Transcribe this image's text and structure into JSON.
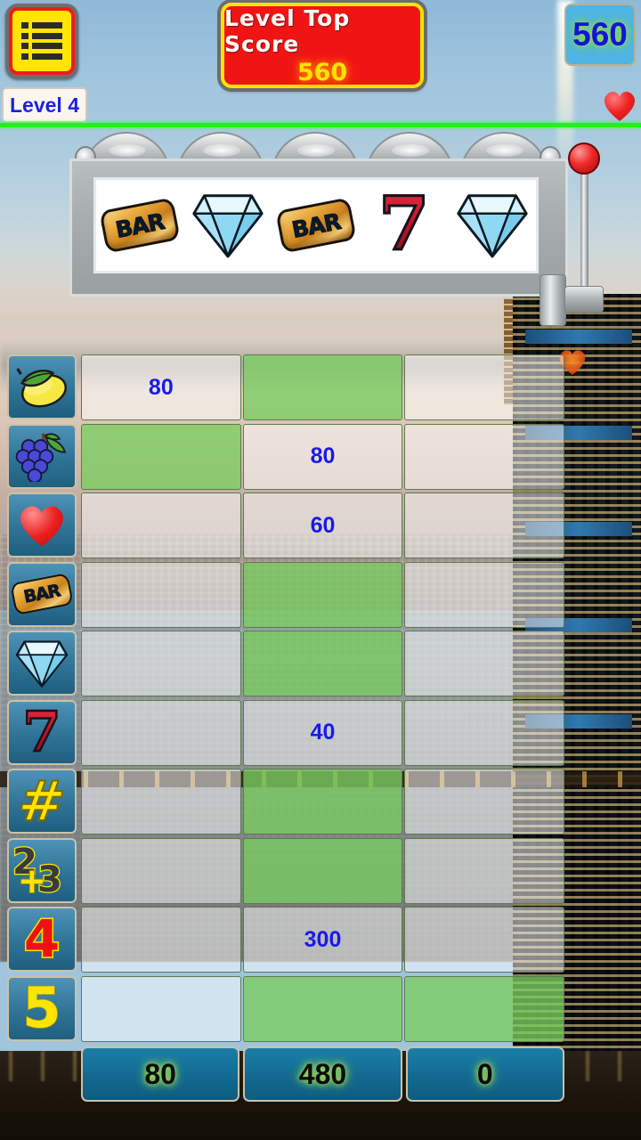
{
  "hud": {
    "menu_icon": "list-menu-icon",
    "level_label": "Level 4",
    "top_score_label": "Level Top Score",
    "top_score_value": "560",
    "current_score": "560",
    "life_icon": "heart-icon",
    "colors": {
      "panel_red": "#f01414",
      "panel_border_yellow": "#ffe400",
      "score_blue": "#1414d8",
      "score_box_bg": "#4fb4e3",
      "divider_green": "#22ef22"
    }
  },
  "slot_machine": {
    "reel_count": 5,
    "reels": [
      {
        "symbol": "bar",
        "label": "BAR"
      },
      {
        "symbol": "diamond",
        "label": ""
      },
      {
        "symbol": "bar",
        "label": "BAR"
      },
      {
        "symbol": "seven",
        "label": "7"
      },
      {
        "symbol": "diamond",
        "label": ""
      }
    ],
    "lever_icon": "slot-lever-handle"
  },
  "scorecard": {
    "column_count": 3,
    "rows": [
      {
        "icon": "lemon-icon",
        "cells": [
          {
            "value": "80",
            "state": "neutral"
          },
          {
            "value": "",
            "state": "green"
          },
          {
            "value": "",
            "state": "neutral"
          }
        ]
      },
      {
        "icon": "grapes-icon",
        "cells": [
          {
            "value": "",
            "state": "green"
          },
          {
            "value": "80",
            "state": "neutral"
          },
          {
            "value": "",
            "state": "neutral"
          }
        ]
      },
      {
        "icon": "heart-icon",
        "cells": [
          {
            "value": "",
            "state": "neutral"
          },
          {
            "value": "60",
            "state": "neutral"
          },
          {
            "value": "",
            "state": "neutral"
          }
        ]
      },
      {
        "icon": "bar-icon",
        "cells": [
          {
            "value": "",
            "state": "neutral"
          },
          {
            "value": "",
            "state": "green"
          },
          {
            "value": "",
            "state": "neutral"
          }
        ]
      },
      {
        "icon": "diamond-icon",
        "cells": [
          {
            "value": "",
            "state": "neutral"
          },
          {
            "value": "",
            "state": "green"
          },
          {
            "value": "",
            "state": "neutral"
          }
        ]
      },
      {
        "icon": "seven-icon",
        "cells": [
          {
            "value": "",
            "state": "neutral"
          },
          {
            "value": "40",
            "state": "neutral"
          },
          {
            "value": "",
            "state": "neutral"
          }
        ]
      },
      {
        "icon": "hash-icon",
        "cells": [
          {
            "value": "",
            "state": "neutral"
          },
          {
            "value": "",
            "state": "green"
          },
          {
            "value": "",
            "state": "neutral"
          }
        ]
      },
      {
        "icon": "two-plus-three-icon",
        "cells": [
          {
            "value": "",
            "state": "neutral"
          },
          {
            "value": "",
            "state": "green"
          },
          {
            "value": "",
            "state": "neutral"
          }
        ]
      },
      {
        "icon": "four-icon",
        "cells": [
          {
            "value": "",
            "state": "neutral"
          },
          {
            "value": "300",
            "state": "neutral"
          },
          {
            "value": "",
            "state": "neutral"
          }
        ]
      },
      {
        "icon": "five-icon",
        "cells": [
          {
            "value": "",
            "state": "neutral"
          },
          {
            "value": "",
            "state": "green"
          },
          {
            "value": "",
            "state": "green"
          }
        ]
      }
    ],
    "totals": [
      "80",
      "480",
      "0"
    ],
    "colors": {
      "cell_green": "#7ace60",
      "cell_neutral": "#ffffff",
      "cell_border": "#5f7a4e",
      "value_blue": "#1a1ae6",
      "total_bg": "#12688f",
      "total_glow": "#8fe02f",
      "icon_bg": "#2f7396"
    }
  }
}
